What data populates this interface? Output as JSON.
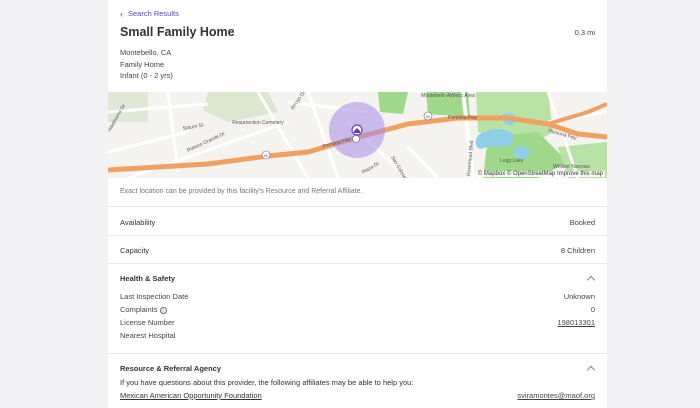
{
  "nav": {
    "back_label": "Search Results"
  },
  "header": {
    "title": "Small Family Home",
    "distance": "0.3 mi"
  },
  "meta": {
    "location": "Montebello, CA",
    "type": "Family Home",
    "ages": "Infant (0 - 2 yrs)"
  },
  "map": {
    "labels": {
      "cemetery": "Resurrection Cemetery",
      "athletic": "Montebello Athletic Area",
      "pomona1": "Pomona Fwy",
      "pomona2": "Pomona Fwy",
      "pomona3": "Pomona Fwy",
      "potrero": "Potrero Grande Dr",
      "saturn": "Saturn St",
      "arroyo": "Arroyo Dr",
      "legg": "Legg Lake",
      "whittier": "Whittier Narrows",
      "rosemead": "Rosemead Blvd",
      "sangabriel": "San Gabriel",
      "plaza": "Plaza Dr",
      "hawthorne": "Hawthorne Dr",
      "shield60": "60",
      "shield60b": "60"
    },
    "attribution": "© Mapbox © OpenStreetMap Improve this map",
    "colors": {
      "freeway": "#f0a060",
      "park": "#9fd88a",
      "water": "#8fd0e8",
      "radius": "#a58be6",
      "pin": "#5b3fc4"
    }
  },
  "note": "Exact location can be provided by this facility's Resource and Referral Affiliate.",
  "availability": {
    "label": "Availability",
    "value": "Booked"
  },
  "capacity": {
    "label": "Capacity",
    "value": "8 Children"
  },
  "health": {
    "title": "Health & Safety",
    "items": [
      {
        "label": "Last Inspection Date",
        "value": "Unknown"
      },
      {
        "label": "Complaints",
        "value": "0"
      },
      {
        "label": "License Number",
        "value": "198013301"
      },
      {
        "label": "Nearest Hospital",
        "value": ""
      }
    ]
  },
  "agency": {
    "title": "Resource & Referral Agency",
    "description": "If you have questions about this provider, the following affiliates may be able to help you:",
    "name": "Mexican American Opportunity Foundation",
    "email": "sviramontes@maof.org"
  }
}
